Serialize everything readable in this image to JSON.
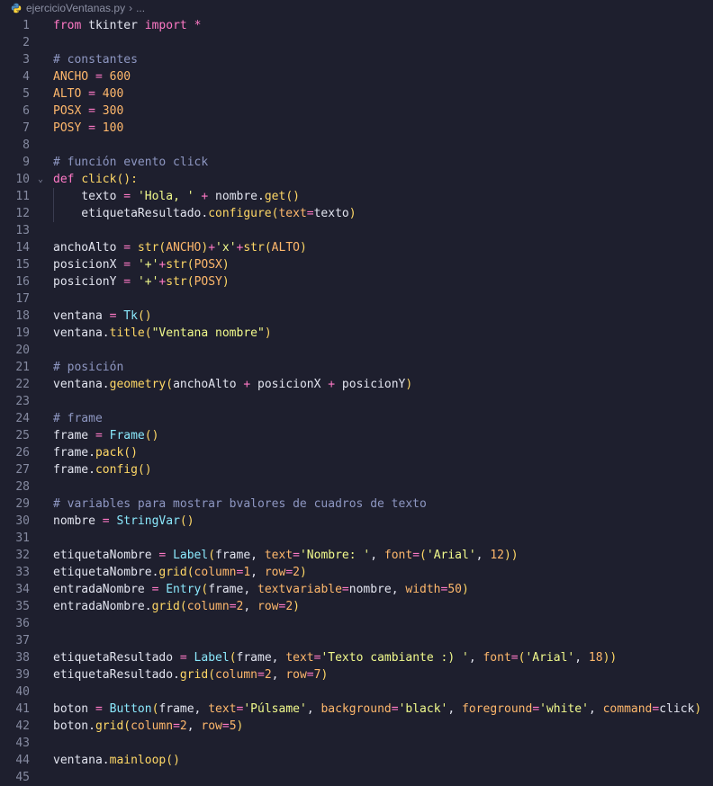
{
  "breadcrumb": {
    "file": "ejercicioVentanas.py",
    "ellipsis": "..."
  },
  "colors": {
    "background": "#1e1f2e",
    "keyword": "#ff79c6",
    "function": "#ffd866",
    "type": "#8be9fd",
    "comment": "#8e97c2",
    "string": "#f1fa8c",
    "number": "#ffb86c",
    "line_number": "#858aa0"
  },
  "lines": [
    {
      "n": "1",
      "tokens": [
        [
          "kw",
          "from"
        ],
        [
          "nm",
          " tkinter "
        ],
        [
          "kw",
          "import"
        ],
        [
          "nm",
          " "
        ],
        [
          "op",
          "*"
        ]
      ]
    },
    {
      "n": "2",
      "tokens": []
    },
    {
      "n": "3",
      "tokens": [
        [
          "co",
          "# constantes"
        ]
      ]
    },
    {
      "n": "4",
      "tokens": [
        [
          "nu",
          "ANCHO"
        ],
        [
          "nm",
          " "
        ],
        [
          "op",
          "="
        ],
        [
          "nm",
          " "
        ],
        [
          "nu",
          "600"
        ]
      ]
    },
    {
      "n": "5",
      "tokens": [
        [
          "nu",
          "ALTO"
        ],
        [
          "nm",
          " "
        ],
        [
          "op",
          "="
        ],
        [
          "nm",
          " "
        ],
        [
          "nu",
          "400"
        ]
      ]
    },
    {
      "n": "6",
      "tokens": [
        [
          "nu",
          "POSX"
        ],
        [
          "nm",
          " "
        ],
        [
          "op",
          "="
        ],
        [
          "nm",
          " "
        ],
        [
          "nu",
          "300"
        ]
      ]
    },
    {
      "n": "7",
      "tokens": [
        [
          "nu",
          "POSY"
        ],
        [
          "nm",
          " "
        ],
        [
          "op",
          "="
        ],
        [
          "nm",
          " "
        ],
        [
          "nu",
          "100"
        ]
      ]
    },
    {
      "n": "8",
      "tokens": []
    },
    {
      "n": "9",
      "tokens": [
        [
          "co",
          "# función evento click"
        ]
      ]
    },
    {
      "n": "10",
      "fold": true,
      "tokens": [
        [
          "kw",
          "def"
        ],
        [
          "nm",
          " "
        ],
        [
          "fn",
          "click"
        ],
        [
          "pn",
          "():"
        ]
      ]
    },
    {
      "n": "11",
      "guide": true,
      "tokens": [
        [
          "nm",
          "    texto "
        ],
        [
          "op",
          "="
        ],
        [
          "nm",
          " "
        ],
        [
          "st",
          "'Hola, '"
        ],
        [
          "nm",
          " "
        ],
        [
          "op",
          "+"
        ],
        [
          "nm",
          " nombre."
        ],
        [
          "fn",
          "get"
        ],
        [
          "pn",
          "()"
        ]
      ]
    },
    {
      "n": "12",
      "guide": true,
      "tokens": [
        [
          "nm",
          "    etiquetaResultado."
        ],
        [
          "fn",
          "configure"
        ],
        [
          "pn",
          "("
        ],
        [
          "pa",
          "text"
        ],
        [
          "op",
          "="
        ],
        [
          "nm",
          "texto"
        ],
        [
          "pn",
          ")"
        ]
      ]
    },
    {
      "n": "13",
      "tokens": []
    },
    {
      "n": "14",
      "tokens": [
        [
          "nm",
          "anchoAlto "
        ],
        [
          "op",
          "="
        ],
        [
          "nm",
          " "
        ],
        [
          "fn",
          "str"
        ],
        [
          "pn",
          "("
        ],
        [
          "nu",
          "ANCHO"
        ],
        [
          "pn",
          ")"
        ],
        [
          "op",
          "+"
        ],
        [
          "st",
          "'x'"
        ],
        [
          "op",
          "+"
        ],
        [
          "fn",
          "str"
        ],
        [
          "pn",
          "("
        ],
        [
          "nu",
          "ALTO"
        ],
        [
          "pn",
          ")"
        ]
      ]
    },
    {
      "n": "15",
      "tokens": [
        [
          "nm",
          "posicionX "
        ],
        [
          "op",
          "="
        ],
        [
          "nm",
          " "
        ],
        [
          "st",
          "'+'"
        ],
        [
          "op",
          "+"
        ],
        [
          "fn",
          "str"
        ],
        [
          "pn",
          "("
        ],
        [
          "nu",
          "POSX"
        ],
        [
          "pn",
          ")"
        ]
      ]
    },
    {
      "n": "16",
      "tokens": [
        [
          "nm",
          "posicionY "
        ],
        [
          "op",
          "="
        ],
        [
          "nm",
          " "
        ],
        [
          "st",
          "'+'"
        ],
        [
          "op",
          "+"
        ],
        [
          "fn",
          "str"
        ],
        [
          "pn",
          "("
        ],
        [
          "nu",
          "POSY"
        ],
        [
          "pn",
          ")"
        ]
      ]
    },
    {
      "n": "17",
      "tokens": []
    },
    {
      "n": "18",
      "tokens": [
        [
          "nm",
          "ventana "
        ],
        [
          "op",
          "="
        ],
        [
          "nm",
          " "
        ],
        [
          "ty",
          "Tk"
        ],
        [
          "pn",
          "()"
        ]
      ]
    },
    {
      "n": "19",
      "tokens": [
        [
          "nm",
          "ventana."
        ],
        [
          "fn",
          "title"
        ],
        [
          "pn",
          "("
        ],
        [
          "st",
          "\"Ventana nombre\""
        ],
        [
          "pn",
          ")"
        ]
      ]
    },
    {
      "n": "20",
      "tokens": []
    },
    {
      "n": "21",
      "tokens": [
        [
          "co",
          "# posición"
        ]
      ]
    },
    {
      "n": "22",
      "tokens": [
        [
          "nm",
          "ventana."
        ],
        [
          "fn",
          "geometry"
        ],
        [
          "pn",
          "("
        ],
        [
          "nm",
          "anchoAlto "
        ],
        [
          "op",
          "+"
        ],
        [
          "nm",
          " posicionX "
        ],
        [
          "op",
          "+"
        ],
        [
          "nm",
          " posicionY"
        ],
        [
          "pn",
          ")"
        ]
      ]
    },
    {
      "n": "23",
      "tokens": []
    },
    {
      "n": "24",
      "tokens": [
        [
          "co",
          "# frame"
        ]
      ]
    },
    {
      "n": "25",
      "tokens": [
        [
          "nm",
          "frame "
        ],
        [
          "op",
          "="
        ],
        [
          "nm",
          " "
        ],
        [
          "ty",
          "Frame"
        ],
        [
          "pn",
          "()"
        ]
      ]
    },
    {
      "n": "26",
      "tokens": [
        [
          "nm",
          "frame."
        ],
        [
          "fn",
          "pack"
        ],
        [
          "pn",
          "()"
        ]
      ]
    },
    {
      "n": "27",
      "tokens": [
        [
          "nm",
          "frame."
        ],
        [
          "fn",
          "config"
        ],
        [
          "pn",
          "()"
        ]
      ]
    },
    {
      "n": "28",
      "tokens": []
    },
    {
      "n": "29",
      "tokens": [
        [
          "co",
          "# variables para mostrar bvalores de cuadros de texto"
        ]
      ]
    },
    {
      "n": "30",
      "tokens": [
        [
          "nm",
          "nombre "
        ],
        [
          "op",
          "="
        ],
        [
          "nm",
          " "
        ],
        [
          "ty",
          "StringVar"
        ],
        [
          "pn",
          "()"
        ]
      ]
    },
    {
      "n": "31",
      "tokens": []
    },
    {
      "n": "32",
      "tokens": [
        [
          "nm",
          "etiquetaNombre "
        ],
        [
          "op",
          "="
        ],
        [
          "nm",
          " "
        ],
        [
          "ty",
          "Label"
        ],
        [
          "pn",
          "("
        ],
        [
          "nm",
          "frame, "
        ],
        [
          "pa",
          "text"
        ],
        [
          "op",
          "="
        ],
        [
          "st",
          "'Nombre: '"
        ],
        [
          "nm",
          ", "
        ],
        [
          "pa",
          "font"
        ],
        [
          "op",
          "="
        ],
        [
          "pn",
          "("
        ],
        [
          "st",
          "'Arial'"
        ],
        [
          "nm",
          ", "
        ],
        [
          "nu",
          "12"
        ],
        [
          "pn",
          "))"
        ]
      ]
    },
    {
      "n": "33",
      "tokens": [
        [
          "nm",
          "etiquetaNombre."
        ],
        [
          "fn",
          "grid"
        ],
        [
          "pn",
          "("
        ],
        [
          "pa",
          "column"
        ],
        [
          "op",
          "="
        ],
        [
          "nu",
          "1"
        ],
        [
          "nm",
          ", "
        ],
        [
          "pa",
          "row"
        ],
        [
          "op",
          "="
        ],
        [
          "nu",
          "2"
        ],
        [
          "pn",
          ")"
        ]
      ]
    },
    {
      "n": "34",
      "tokens": [
        [
          "nm",
          "entradaNombre "
        ],
        [
          "op",
          "="
        ],
        [
          "nm",
          " "
        ],
        [
          "ty",
          "Entry"
        ],
        [
          "pn",
          "("
        ],
        [
          "nm",
          "frame, "
        ],
        [
          "pa",
          "textvariable"
        ],
        [
          "op",
          "="
        ],
        [
          "nm",
          "nombre, "
        ],
        [
          "pa",
          "width"
        ],
        [
          "op",
          "="
        ],
        [
          "nu",
          "50"
        ],
        [
          "pn",
          ")"
        ]
      ]
    },
    {
      "n": "35",
      "tokens": [
        [
          "nm",
          "entradaNombre."
        ],
        [
          "fn",
          "grid"
        ],
        [
          "pn",
          "("
        ],
        [
          "pa",
          "column"
        ],
        [
          "op",
          "="
        ],
        [
          "nu",
          "2"
        ],
        [
          "nm",
          ", "
        ],
        [
          "pa",
          "row"
        ],
        [
          "op",
          "="
        ],
        [
          "nu",
          "2"
        ],
        [
          "pn",
          ")"
        ]
      ]
    },
    {
      "n": "36",
      "tokens": []
    },
    {
      "n": "37",
      "tokens": []
    },
    {
      "n": "38",
      "tokens": [
        [
          "nm",
          "etiquetaResultado "
        ],
        [
          "op",
          "="
        ],
        [
          "nm",
          " "
        ],
        [
          "ty",
          "Label"
        ],
        [
          "pn",
          "("
        ],
        [
          "nm",
          "frame, "
        ],
        [
          "pa",
          "text"
        ],
        [
          "op",
          "="
        ],
        [
          "st",
          "'Texto cambiante :) '"
        ],
        [
          "nm",
          ", "
        ],
        [
          "pa",
          "font"
        ],
        [
          "op",
          "="
        ],
        [
          "pn",
          "("
        ],
        [
          "st",
          "'Arial'"
        ],
        [
          "nm",
          ", "
        ],
        [
          "nu",
          "18"
        ],
        [
          "pn",
          "))"
        ]
      ]
    },
    {
      "n": "39",
      "tokens": [
        [
          "nm",
          "etiquetaResultado."
        ],
        [
          "fn",
          "grid"
        ],
        [
          "pn",
          "("
        ],
        [
          "pa",
          "column"
        ],
        [
          "op",
          "="
        ],
        [
          "nu",
          "2"
        ],
        [
          "nm",
          ", "
        ],
        [
          "pa",
          "row"
        ],
        [
          "op",
          "="
        ],
        [
          "nu",
          "7"
        ],
        [
          "pn",
          ")"
        ]
      ]
    },
    {
      "n": "40",
      "tokens": []
    },
    {
      "n": "41",
      "tokens": [
        [
          "nm",
          "boton "
        ],
        [
          "op",
          "="
        ],
        [
          "nm",
          " "
        ],
        [
          "ty",
          "Button"
        ],
        [
          "pn",
          "("
        ],
        [
          "nm",
          "frame, "
        ],
        [
          "pa",
          "text"
        ],
        [
          "op",
          "="
        ],
        [
          "st",
          "'Púlsame'"
        ],
        [
          "nm",
          ", "
        ],
        [
          "pa",
          "background"
        ],
        [
          "op",
          "="
        ],
        [
          "st",
          "'black'"
        ],
        [
          "nm",
          ", "
        ],
        [
          "pa",
          "foreground"
        ],
        [
          "op",
          "="
        ],
        [
          "st",
          "'white'"
        ],
        [
          "nm",
          ", "
        ],
        [
          "pa",
          "command"
        ],
        [
          "op",
          "="
        ],
        [
          "nm",
          "click"
        ],
        [
          "pn",
          ")"
        ]
      ]
    },
    {
      "n": "42",
      "tokens": [
        [
          "nm",
          "boton."
        ],
        [
          "fn",
          "grid"
        ],
        [
          "pn",
          "("
        ],
        [
          "pa",
          "column"
        ],
        [
          "op",
          "="
        ],
        [
          "nu",
          "2"
        ],
        [
          "nm",
          ", "
        ],
        [
          "pa",
          "row"
        ],
        [
          "op",
          "="
        ],
        [
          "nu",
          "5"
        ],
        [
          "pn",
          ")"
        ]
      ]
    },
    {
      "n": "43",
      "tokens": []
    },
    {
      "n": "44",
      "tokens": [
        [
          "nm",
          "ventana."
        ],
        [
          "fn",
          "mainloop"
        ],
        [
          "pn",
          "()"
        ]
      ]
    },
    {
      "n": "45",
      "tokens": []
    }
  ]
}
